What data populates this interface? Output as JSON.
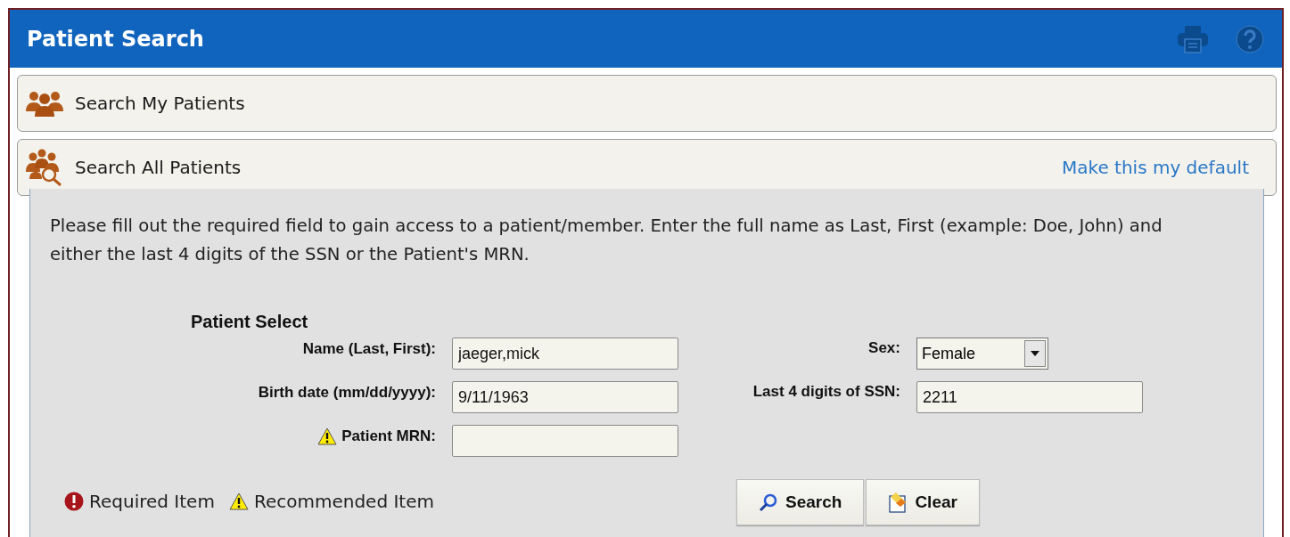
{
  "window": {
    "title": "Patient Search"
  },
  "sections": [
    {
      "title": "Search My Patients",
      "kind": "group",
      "expanded": false
    },
    {
      "title": "Search All Patients",
      "kind": "group-search",
      "expanded": true,
      "link": "Make this my default"
    }
  ],
  "instructions": "Please fill out the required field to gain access to a patient/member. Enter the full name as Last, First (example: Doe, John) and either the last 4 digits of the SSN or the Patient's MRN.",
  "form": {
    "title": "Patient Select",
    "left_fields": [
      {
        "label": "Name (Last, First):",
        "value": "jaeger,mick",
        "kind": "text",
        "recommended": false
      },
      {
        "label": "Birth date (mm/dd/yyyy):",
        "value": "9/11/1963",
        "kind": "text",
        "recommended": false
      },
      {
        "label": "Patient MRN:",
        "kind": "text",
        "recommended": true
      }
    ],
    "right_fields": [
      {
        "label": "Sex:",
        "value": "Female",
        "kind": "select",
        "recommended": false
      },
      {
        "label": "Last 4 digits of SSN:",
        "value": "2211",
        "kind": "text",
        "recommended": false
      }
    ]
  },
  "legend": [
    {
      "kind": "required",
      "label": "Required Item"
    },
    {
      "kind": "recommended",
      "label": "Recommended Item"
    }
  ],
  "buttons": [
    {
      "label": "Search",
      "kind": "search"
    },
    {
      "label": "Clear",
      "kind": "clear"
    }
  ]
}
